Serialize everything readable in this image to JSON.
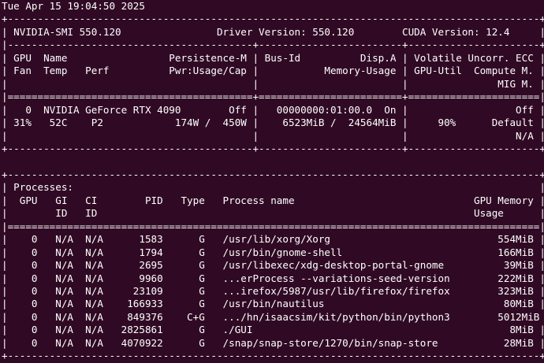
{
  "window": {
    "title": "nvidia-smi"
  },
  "terminal": {
    "lines": [
      "Tue Apr 15 19:04:50 2025",
      "+-----------------------------------------------------------------------------------------+",
      "| NVIDIA-SMI 550.120                Driver Version: 550.120        CUDA Version: 12.4     |",
      "|-----------------------------------------+------------------------+----------------------+",
      "| GPU  Name                 Persistence-M | Bus-Id          Disp.A | Volatile Uncorr. ECC |",
      "| Fan  Temp   Perf          Pwr:Usage/Cap |           Memory-Usage | GPU-Util  Compute M. |",
      "|                                         |                        |               MIG M. |",
      "|=========================================+========================+======================|",
      "|   0  NVIDIA GeForce RTX 4090        Off |   00000000:01:00.0  On |                  Off |",
      "| 31%   52C    P2            174W /  450W |    6523MiB /  24564MiB |     90%      Default |",
      "|                                         |                        |                  N/A |",
      "+-----------------------------------------+------------------------+----------------------+",
      "",
      "+-----------------------------------------------------------------------------------------+",
      "| Processes:                                                                              |",
      "|  GPU   GI   CI        PID   Type   Process name                              GPU Memory |",
      "|        ID   ID                                                               Usage      |",
      "|=========================================================================================|",
      "|    0   N/A  N/A      1583      G   /usr/lib/xorg/Xorg                            554MiB |",
      "|    0   N/A  N/A      1794      G   /usr/bin/gnome-shell                          166MiB |",
      "|    0   N/A  N/A      2695      G   /usr/libexec/xdg-desktop-portal-gnome          39MiB |",
      "|    0   N/A  N/A      9960      G   ...erProcess --variations-seed-version        222MiB |",
      "|    0   N/A  N/A     23109      G   ...irefox/5987/usr/lib/firefox/firefox        323MiB |",
      "|    0   N/A  N/A    166933      G   /usr/bin/nautilus                              80MiB |",
      "|    0   N/A  N/A    849376    C+G   .../hn/isaacsim/kit/python/bin/python3        5012MiB |",
      "|    0   N/A  N/A   2825861      G   ./GUI                                           8MiB |",
      "|    0   N/A  N/A   4070922      G   /snap/snap-store/1270/bin/snap-store           28MiB |",
      "+-----------------------------------------------------------------------------------------+"
    ]
  },
  "colors": {
    "background": "#300a24",
    "foreground": "#ffffff"
  }
}
